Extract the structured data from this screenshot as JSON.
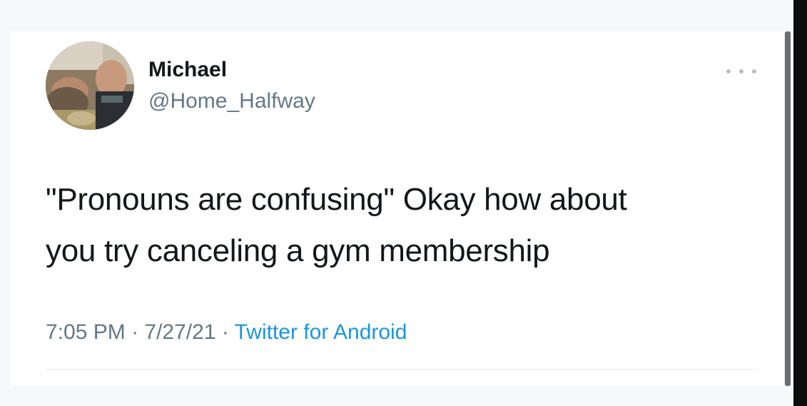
{
  "tweet": {
    "author_name": "Michael",
    "author_handle": "@Home_Halfway",
    "text_line1": "\"Pronouns are confusing\" Okay how about",
    "text_line2": "you try canceling a gym membership",
    "time": "7:05 PM",
    "separator1": " · ",
    "date": "7/27/21",
    "separator2": " · ",
    "source": "Twitter for Android"
  },
  "icons": {
    "more": "more-options-icon"
  },
  "colors": {
    "name": "#14171a",
    "secondary": "#657786",
    "link": "#1b95e0",
    "divider": "#e6ecf0"
  }
}
